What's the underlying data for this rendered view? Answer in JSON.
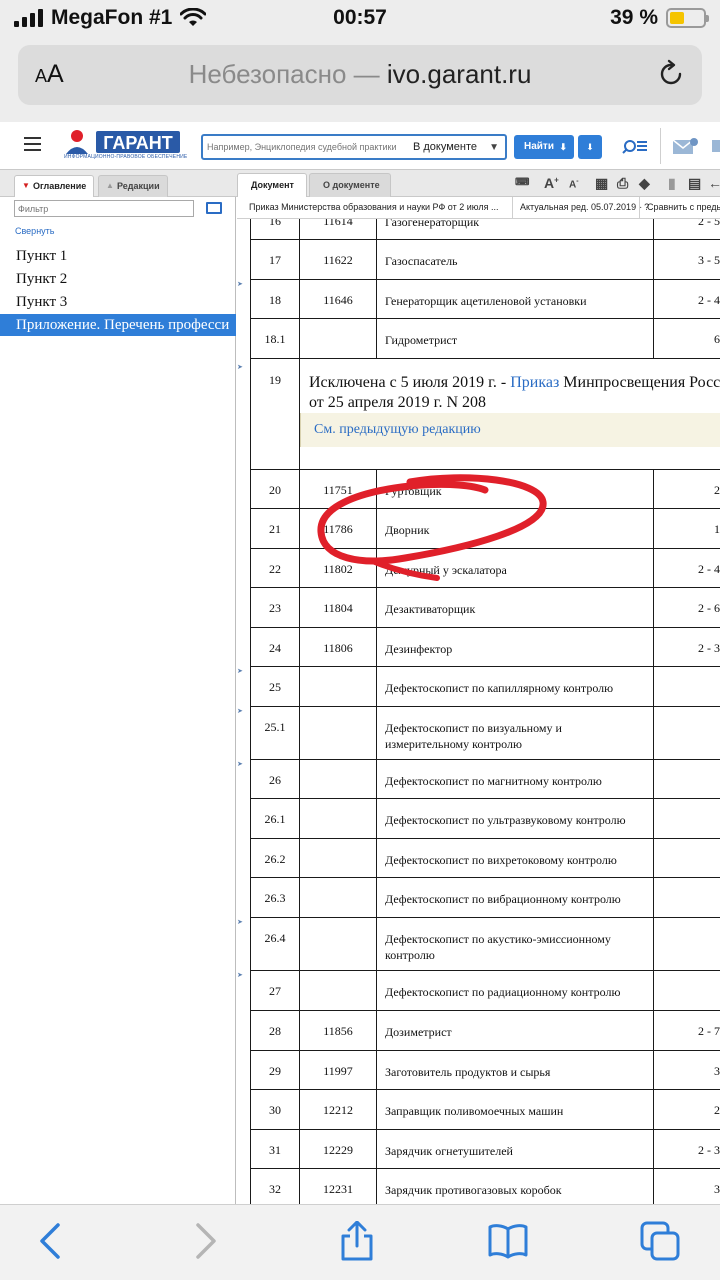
{
  "status_bar": {
    "carrier": "MegaFon #1",
    "time": "00:57",
    "battery": "39 %"
  },
  "browser": {
    "text_size_label_small": "A",
    "text_size_label_large": "A",
    "url_security": "Небезопасно —",
    "url_domain": "ivo.garant.ru"
  },
  "app_header": {
    "logo_text": "ГАРАНТ",
    "logo_caption": "ИНФОРМАЦИОННО-ПРАВОВОЕ ОБЕСПЕЧЕНИЕ",
    "search_placeholder": "Например, Энциклопедия судебной практики",
    "search_scope": "В документе",
    "find_label": "Найти"
  },
  "left_tabs": [
    {
      "label": "Оглавление"
    },
    {
      "label": "Редакции"
    }
  ],
  "doc_tabs": [
    {
      "label": "Документ"
    },
    {
      "label": "О документе"
    }
  ],
  "sidebar": {
    "filter_placeholder": "Фильтр",
    "collapse_label": "Свернуть",
    "items": [
      {
        "label": "Пункт 1"
      },
      {
        "label": "Пункт 2"
      },
      {
        "label": "Пункт 3"
      },
      {
        "label": "Приложение. Перечень професси"
      }
    ]
  },
  "doc_bar": {
    "title": "Приказ Министерства образования и науки РФ от 2 июля ...",
    "edition": "Актуальная ред. 05.07.2019 - ?",
    "compare": "Сравнить с предыду"
  },
  "table": {
    "rows": [
      {
        "num": "16",
        "code": "11614",
        "name": "Газогенераторщик",
        "grade": "2 - 5"
      },
      {
        "num": "17",
        "code": "11622",
        "name": "Газоспасатель",
        "grade": "3 - 5"
      },
      {
        "num": "18",
        "code": "11646",
        "name": "Генераторщик ацетиленовой установки",
        "grade": "2 - 4"
      },
      {
        "num": "18.1",
        "code": "",
        "name": "Гидрометрист",
        "grade": "6"
      }
    ],
    "excluded": {
      "num": "19",
      "line1_prefix": "Исключена с 5 июля 2019 г. -",
      "line1_link": "Приказ",
      "line1_suffix": "Минпросвещения Росс",
      "line2": "от 25 апреля 2019 г. N 208",
      "prev_edition_link": "См. предыдущую редакцию"
    },
    "rows_after": [
      {
        "num": "20",
        "code": "11751",
        "name": "Гуртовщик",
        "grade": "2"
      },
      {
        "num": "21",
        "code": "11786",
        "name": "Дворник",
        "grade": "1"
      },
      {
        "num": "22",
        "code": "11802",
        "name": "Дежурный у эскалатора",
        "grade": "2 - 4"
      },
      {
        "num": "23",
        "code": "11804",
        "name": "Дезактиваторщик",
        "grade": "2 - 6"
      },
      {
        "num": "24",
        "code": "11806",
        "name": "Дезинфектор",
        "grade": "2 - 3"
      },
      {
        "num": "25",
        "code": "",
        "name": "Дефектоскопист по капиллярному контролю",
        "grade": ""
      },
      {
        "num": "25.1",
        "code": "",
        "name": "Дефектоскопист по визуальному и измерительному контролю",
        "grade": ""
      },
      {
        "num": "26",
        "code": "",
        "name": "Дефектоскопист по магнитному контролю",
        "grade": ""
      },
      {
        "num": "26.1",
        "code": "",
        "name": "Дефектоскопист по ультразвуковому контролю",
        "grade": ""
      },
      {
        "num": "26.2",
        "code": "",
        "name": "Дефектоскопист по вихретоковому контролю",
        "grade": ""
      },
      {
        "num": "26.3",
        "code": "",
        "name": "Дефектоскопист по вибрационному контролю",
        "grade": ""
      },
      {
        "num": "26.4",
        "code": "",
        "name": "Дефектоскопист по акустико-эмиссионному контролю",
        "grade": ""
      },
      {
        "num": "27",
        "code": "",
        "name": "Дефектоскопист по радиационному контролю",
        "grade": ""
      },
      {
        "num": "28",
        "code": "11856",
        "name": "Дозиметрист",
        "grade": "2 - 7"
      },
      {
        "num": "29",
        "code": "11997",
        "name": "Заготовитель продуктов и сырья",
        "grade": "3"
      },
      {
        "num": "30",
        "code": "12212",
        "name": "Заправщик поливомоечных машин",
        "grade": "2"
      },
      {
        "num": "31",
        "code": "12229",
        "name": "Зарядчик огнетушителей",
        "grade": "2 - 3"
      },
      {
        "num": "32",
        "code": "12231",
        "name": "Зарядчик противогазовых коробок",
        "grade": "3"
      }
    ]
  },
  "colors": {
    "accent": "#2f7ed8",
    "link": "#2a6cc4",
    "annotation": "#e0202a",
    "prev_box": "#f6f3e3"
  },
  "icons": {
    "back": "chevron-left-icon",
    "forward": "chevron-right-icon",
    "share": "share-icon",
    "bookmarks": "book-icon",
    "tabs": "tabs-icon"
  }
}
